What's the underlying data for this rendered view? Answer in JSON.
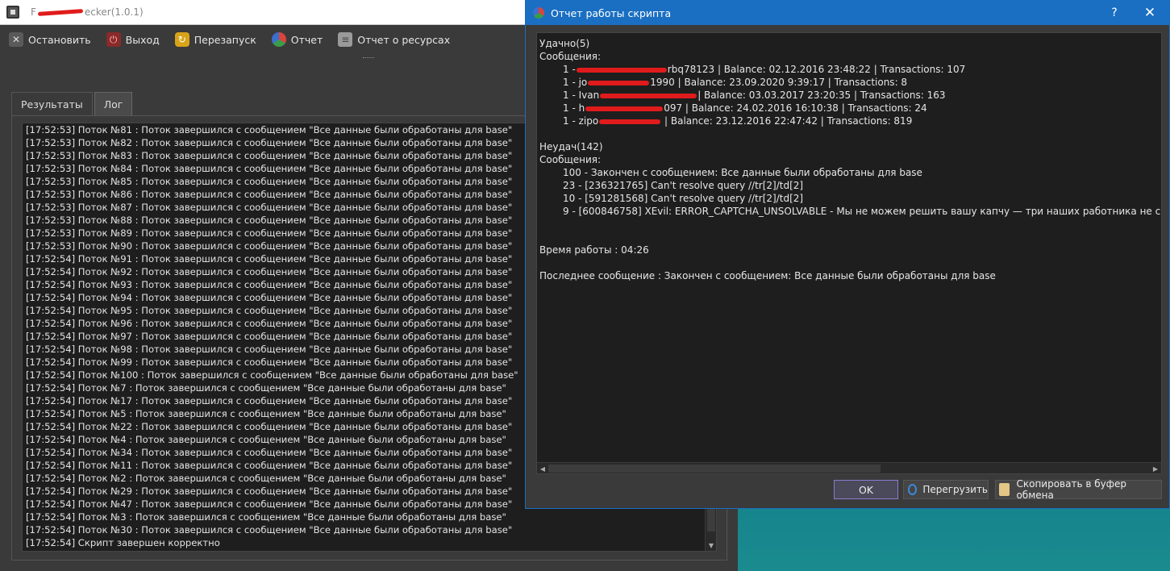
{
  "main_window": {
    "title_prefix": "F",
    "title_suffix": "ecker(1.0.1)",
    "toolbar": {
      "stop": "Остановить",
      "exit": "Выход",
      "restart": "Перезапуск",
      "report": "Отчет",
      "resources": "Отчет о ресурсах"
    },
    "tabs": [
      "Результаты",
      "Лог"
    ],
    "active_tab": "Лог",
    "log_lines": [
      "[17:52:53] Поток №81 : Поток завершился с сообщением \"Все данные были обработаны для base\"",
      "[17:52:53] Поток №82 : Поток завершился с сообщением \"Все данные были обработаны для base\"",
      "[17:52:53] Поток №83 : Поток завершился с сообщением \"Все данные были обработаны для base\"",
      "[17:52:53] Поток №84 : Поток завершился с сообщением \"Все данные были обработаны для base\"",
      "[17:52:53] Поток №85 : Поток завершился с сообщением \"Все данные были обработаны для base\"",
      "[17:52:53] Поток №86 : Поток завершился с сообщением \"Все данные были обработаны для base\"",
      "[17:52:53] Поток №87 : Поток завершился с сообщением \"Все данные были обработаны для base\"",
      "[17:52:53] Поток №88 : Поток завершился с сообщением \"Все данные были обработаны для base\"",
      "[17:52:53] Поток №89 : Поток завершился с сообщением \"Все данные были обработаны для base\"",
      "[17:52:53] Поток №90 : Поток завершился с сообщением \"Все данные были обработаны для base\"",
      "[17:52:54] Поток №91 : Поток завершился с сообщением \"Все данные были обработаны для base\"",
      "[17:52:54] Поток №92 : Поток завершился с сообщением \"Все данные были обработаны для base\"",
      "[17:52:54] Поток №93 : Поток завершился с сообщением \"Все данные были обработаны для base\"",
      "[17:52:54] Поток №94 : Поток завершился с сообщением \"Все данные были обработаны для base\"",
      "[17:52:54] Поток №95 : Поток завершился с сообщением \"Все данные были обработаны для base\"",
      "[17:52:54] Поток №96 : Поток завершился с сообщением \"Все данные были обработаны для base\"",
      "[17:52:54] Поток №97 : Поток завершился с сообщением \"Все данные были обработаны для base\"",
      "[17:52:54] Поток №98 : Поток завершился с сообщением \"Все данные были обработаны для base\"",
      "[17:52:54] Поток №99 : Поток завершился с сообщением \"Все данные были обработаны для base\"",
      "[17:52:54] Поток №100 : Поток завершился с сообщением \"Все данные были обработаны для base\"",
      "[17:52:54] Поток №7 : Поток завершился с сообщением \"Все данные были обработаны для base\"",
      "[17:52:54] Поток №17 : Поток завершился с сообщением \"Все данные были обработаны для base\"",
      "[17:52:54] Поток №5 : Поток завершился с сообщением \"Все данные были обработаны для base\"",
      "[17:52:54] Поток №22 : Поток завершился с сообщением \"Все данные были обработаны для base\"",
      "[17:52:54] Поток №4 : Поток завершился с сообщением \"Все данные были обработаны для base\"",
      "[17:52:54] Поток №34 : Поток завершился с сообщением \"Все данные были обработаны для base\"",
      "[17:52:54] Поток №11 : Поток завершился с сообщением \"Все данные были обработаны для base\"",
      "[17:52:54] Поток №2 : Поток завершился с сообщением \"Все данные были обработаны для base\"",
      "[17:52:54] Поток №29 : Поток завершился с сообщением \"Все данные были обработаны для base\"",
      "[17:52:54] Поток №47 : Поток завершился с сообщением \"Все данные были обработаны для base\"",
      "[17:52:54] Поток №3 : Поток завершился с сообщением \"Все данные были обработаны для base\"",
      "[17:52:54] Поток №30 : Поток завершился с сообщением \"Все данные были обработаны для base\"",
      "[17:52:54] Скрипт завершен корректно"
    ]
  },
  "dialog": {
    "title": "Отчет работы скрипта",
    "help": "?",
    "close": "✕",
    "success_header": "Удачно(5)",
    "messages_label": "Сообщения:",
    "success_items": [
      {
        "prefix": "1 -",
        "tail": "rbq78123 | Balance: 02.12.2016 23:48:22 | Transactions: 107"
      },
      {
        "prefix": "1 - jo",
        "tail": "1990 | Balance: 23.09.2020 9:39:17 | Transactions: 8"
      },
      {
        "prefix": "1 - Ivan",
        "tail": "| Balance: 03.03.2017 23:20:35 | Transactions: 163"
      },
      {
        "prefix": "1 - h",
        "tail": "097 | Balance: 24.02.2016 16:10:38 | Transactions: 24"
      },
      {
        "prefix": "1 - zipo",
        "tail": " | Balance: 23.12.2016 22:47:42 | Transactions: 819"
      }
    ],
    "fail_header": "Неудач(142)",
    "fail_items": [
      "100 - Закончен с сообщением: Все данные были обработаны для base",
      "23 - [236321765] Can't resolve query //tr[2]/td[2]",
      "10 - [591281568] Can't resolve query //tr[2]/td[2]",
      "9 - [600846758] XEvil: ERROR_CAPTCHA_UNSOLVABLE - Мы не можем решить вашу капчу — три наших работника не смогли е"
    ],
    "work_time": "Время работы : 04:26",
    "last_message": "Последнее сообщение : Закончен с сообщением: Все данные были обработаны для base",
    "buttons": {
      "ok": "OK",
      "reload": "Перегрузить",
      "copy": "Скопировать в буфер обмена"
    }
  }
}
